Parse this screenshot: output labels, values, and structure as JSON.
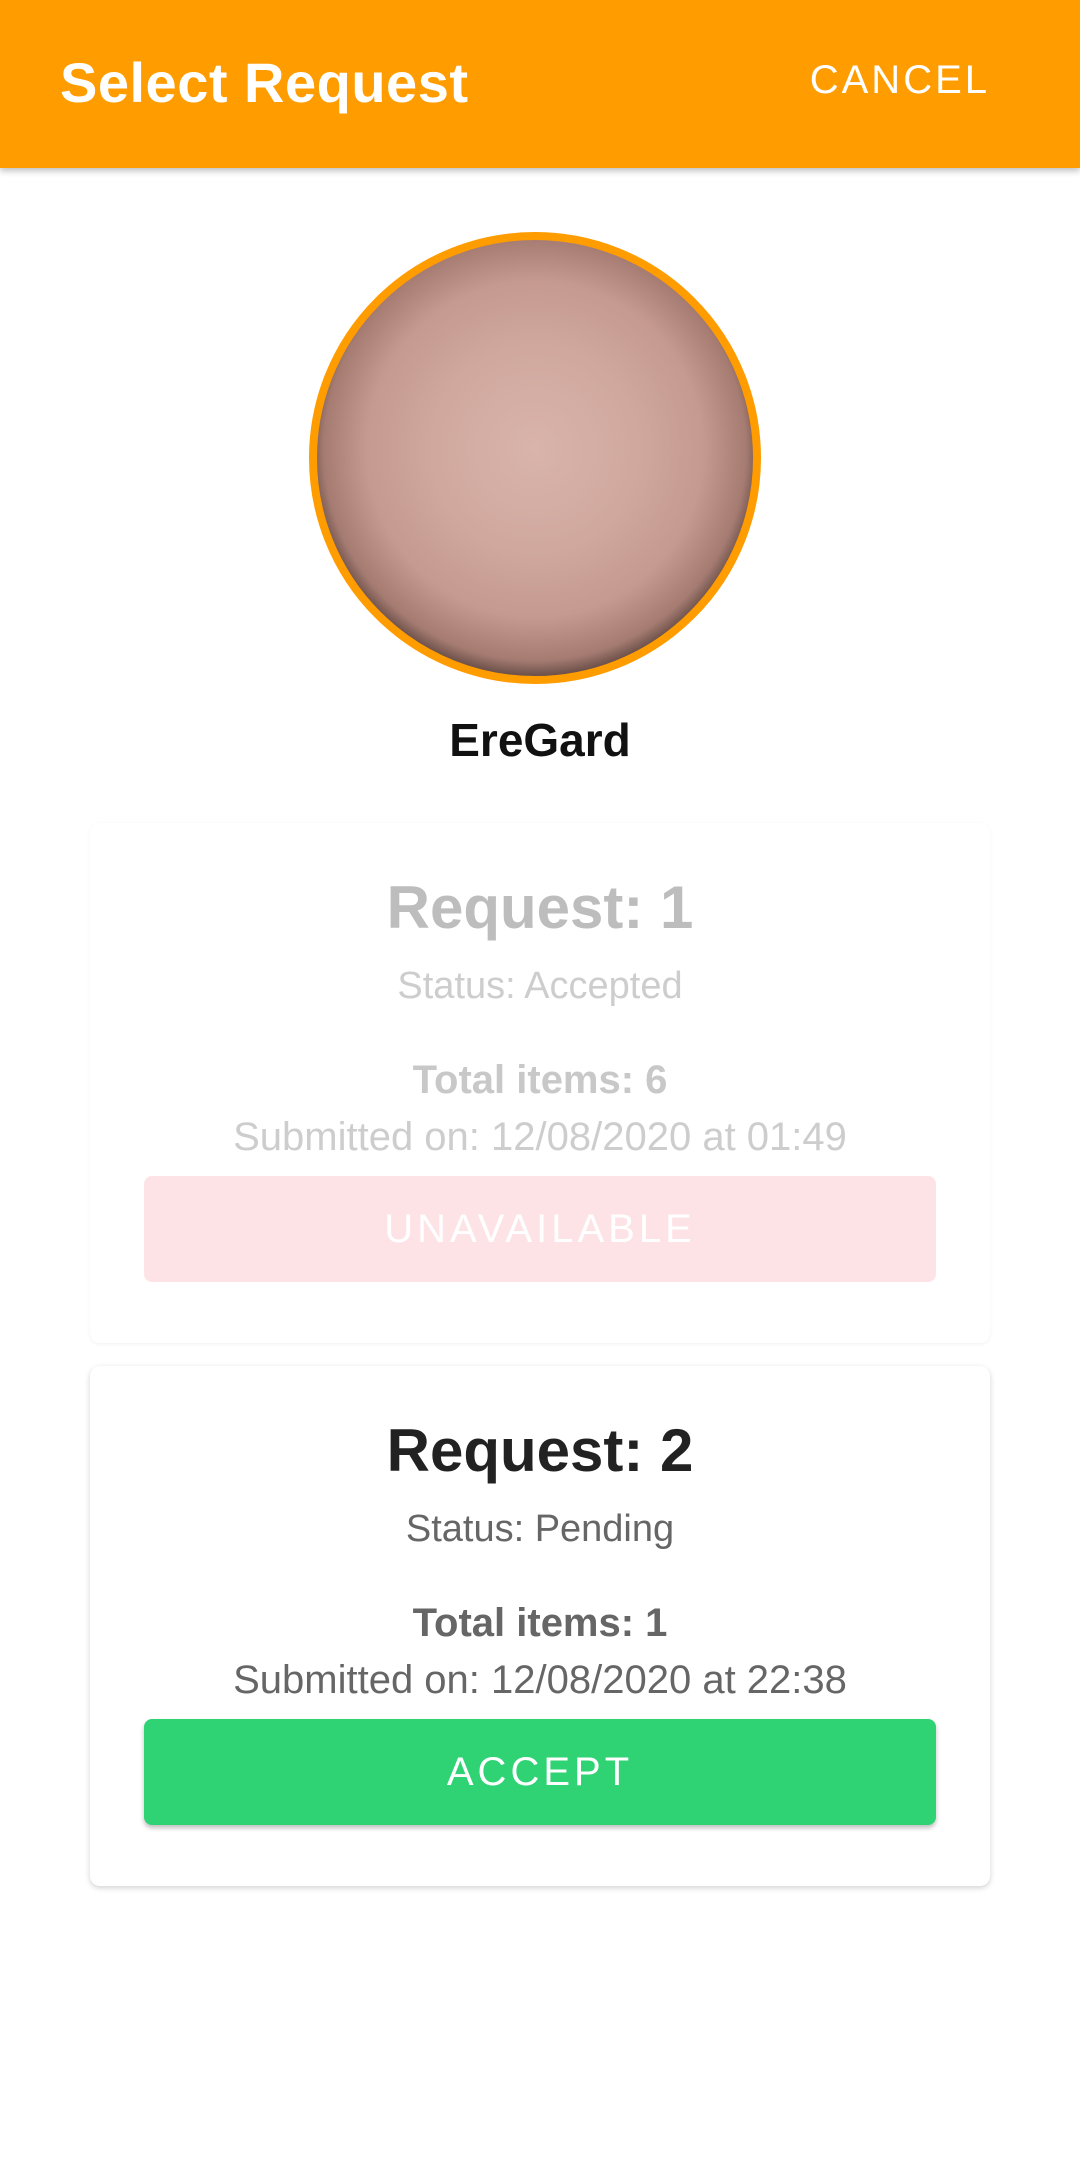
{
  "appbar": {
    "title": "Select Request",
    "action_label": "CANCEL",
    "color": "#ff9c00"
  },
  "profile": {
    "avatar_icon": "user-avatar-photo",
    "username": "EreGard"
  },
  "requests": [
    {
      "title": "Request: 1",
      "status": "Status: Accepted",
      "total_items": "Total items: 6",
      "submitted": "Submitted on: 12/08/2020 at 01:49",
      "button_label": "UNAVAILABLE",
      "button_color": "#fde3e6",
      "enabled": false
    },
    {
      "title": "Request: 2",
      "status": "Status: Pending",
      "total_items": "Total items: 1",
      "submitted": "Submitted on: 12/08/2020 at 22:38",
      "button_label": "ACCEPT",
      "button_color": "#2fd374",
      "enabled": true
    }
  ]
}
